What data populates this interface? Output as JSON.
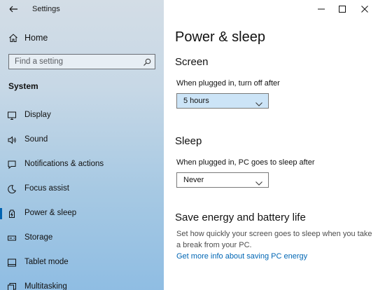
{
  "window": {
    "title": "Settings"
  },
  "sidebar": {
    "home_label": "Home",
    "search_placeholder": "Find a setting",
    "section_label": "System",
    "items": [
      {
        "label": "Display",
        "icon": "display-icon"
      },
      {
        "label": "Sound",
        "icon": "speaker-icon"
      },
      {
        "label": "Notifications & actions",
        "icon": "notification-icon"
      },
      {
        "label": "Focus assist",
        "icon": "moon-icon"
      },
      {
        "label": "Power & sleep",
        "icon": "power-icon",
        "selected": true
      },
      {
        "label": "Storage",
        "icon": "storage-icon"
      },
      {
        "label": "Tablet mode",
        "icon": "tablet-icon"
      },
      {
        "label": "Multitasking",
        "icon": "multitasking-icon"
      }
    ]
  },
  "main": {
    "page_title": "Power & sleep",
    "screen": {
      "heading": "Screen",
      "label": "When plugged in, turn off after",
      "value": "5 hours"
    },
    "sleep": {
      "heading": "Sleep",
      "label": "When plugged in, PC goes to sleep after",
      "value": "Never"
    },
    "energy": {
      "heading": "Save energy and battery life",
      "description": "Set how quickly your screen goes to sleep when you take a break from your PC.",
      "link": "Get more info about saving PC energy"
    }
  },
  "colors": {
    "accent": "#0063b1",
    "link": "#0066b4",
    "dropdown_active": "#cce4f7"
  }
}
